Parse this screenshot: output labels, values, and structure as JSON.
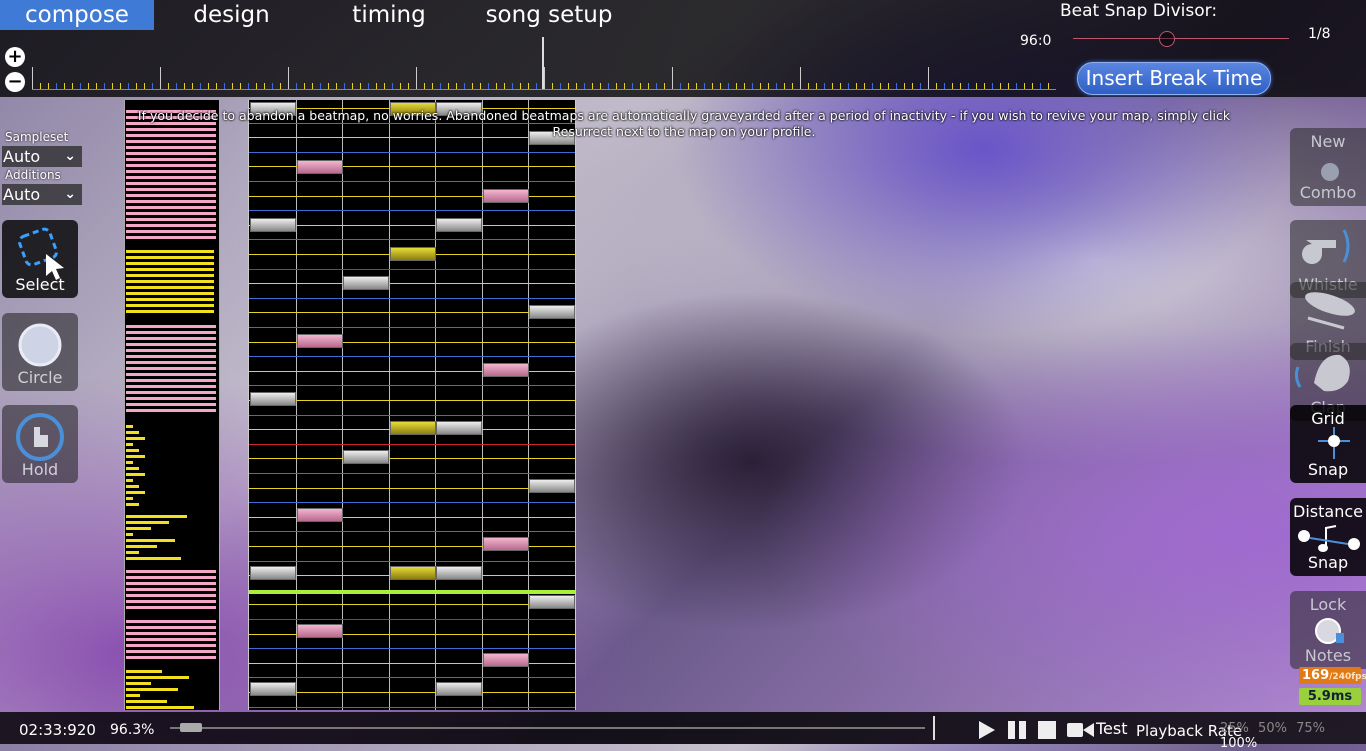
{
  "menu": {
    "tabs": [
      {
        "label": "compose",
        "active": true
      },
      {
        "label": "design",
        "active": false
      },
      {
        "label": "timing",
        "active": false
      },
      {
        "label": "song setup",
        "active": false
      }
    ]
  },
  "beat_snap": {
    "label": "Beat Snap Divisor:",
    "value": "96:0",
    "fraction": "1/8",
    "level": 0.43
  },
  "insert_break_label": "Insert Break Time",
  "notice": "If you decide to abandon a beatmap, no worries. Abandoned beatmaps are automatically graveyarded after a period of inactivity - if you wish to revive your map, simply click Resurrect next to the map on your profile.",
  "sampleset": {
    "label": "Sampleset",
    "value": "Auto"
  },
  "additions": {
    "label": "Additions",
    "value": "Auto"
  },
  "tools": [
    {
      "label": "Select",
      "icon": "select-icon",
      "active": true
    },
    {
      "label": "Circle",
      "icon": "circle-icon",
      "active": false
    },
    {
      "label": "Hold",
      "icon": "hold-icon",
      "active": false
    }
  ],
  "right_buttons": [
    {
      "line1": "New",
      "line2": "Combo",
      "icon": "new-combo-icon",
      "on": false
    },
    {
      "line1": "",
      "line2": "Whistle",
      "icon": "whistle-icon",
      "on": false
    },
    {
      "line1": "",
      "line2": "Finish",
      "icon": "finish-icon",
      "on": false
    },
    {
      "line1": "",
      "line2": "Clap",
      "icon": "clap-icon",
      "on": false
    },
    {
      "line1": "Grid",
      "line2": "Snap",
      "icon": "grid-snap-icon",
      "on": true
    },
    {
      "line1": "Distance",
      "line2": "Snap",
      "icon": "distance-snap-icon",
      "on": true
    },
    {
      "line1": "Lock",
      "line2": "Notes",
      "icon": "lock-notes-icon",
      "on": false
    }
  ],
  "fps": {
    "value": "169",
    "max": "/240fps"
  },
  "latency": "5.9ms",
  "bottom": {
    "time": "02:33:920",
    "percent": "96.3%",
    "progress": 0.963,
    "test_label": "Test",
    "playback_label": "Playback Rate",
    "rates": [
      "25%",
      "50%",
      "75%",
      "100%"
    ],
    "selected_rate": "100%"
  },
  "colors": {
    "accent": "#3f7ad6",
    "pink": "#f4a6c8",
    "yellow": "#f2e01e",
    "beat_red": "#d0262b",
    "beat_blue": "#3b6fd6",
    "beat_yellow": "#e6d321",
    "kiai_green": "#a8f03a"
  },
  "icons": {
    "zoom_in": "plus-icon",
    "zoom_out": "minus-icon",
    "play": "play-icon",
    "pause": "pause-icon",
    "stop": "stop-icon",
    "test": "video-camera-icon"
  }
}
